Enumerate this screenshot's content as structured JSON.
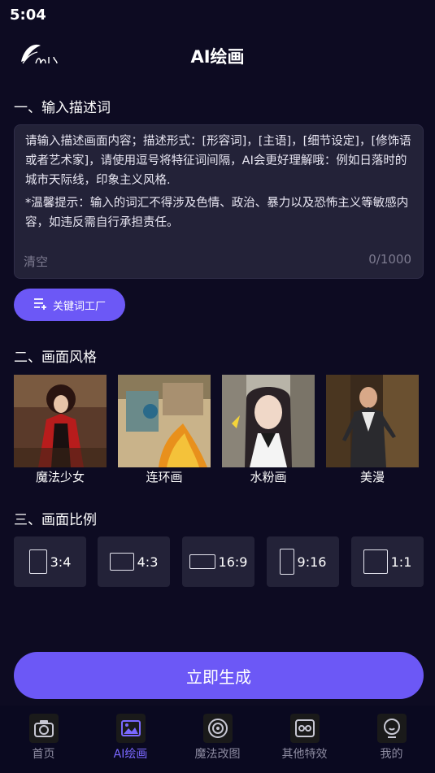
{
  "status_bar": {
    "time": "5:04"
  },
  "header": {
    "title": "AI绘画"
  },
  "section_prompt": {
    "title": "一、输入描述词",
    "placeholder": "请输入描述画面内容；描述形式：[形容词]，[主语]，[细节设定]，[修饰语或者艺术家]，请使用逗号将特征词间隔，AI会更好理解哦：例如日落时的城市天际线，印象主义风格.",
    "tip": "*温馨提示：输入的词汇不得涉及色情、政治、暴力以及恐怖主义等敏感内容，如违反需自行承担责任。",
    "clear_label": "清空",
    "char_count": "0/1000",
    "keyword_button": "关键词工厂"
  },
  "section_style": {
    "title": "二、画面风格",
    "styles": [
      {
        "label": "魔法少女"
      },
      {
        "label": "连环画"
      },
      {
        "label": "水粉画"
      },
      {
        "label": "美漫"
      }
    ]
  },
  "section_ratio": {
    "title": "三、画面比例",
    "ratios": [
      {
        "label": "3:4"
      },
      {
        "label": "4:3"
      },
      {
        "label": "16:9"
      },
      {
        "label": "9:16"
      },
      {
        "label": "1:1"
      }
    ]
  },
  "generate_button": "立即生成",
  "bottom_nav": {
    "active": "AI绘画",
    "items": [
      {
        "label": "首页",
        "icon": "camera-icon"
      },
      {
        "label": "AI绘画",
        "icon": "picture-icon"
      },
      {
        "label": "魔法改图",
        "icon": "target-icon"
      },
      {
        "label": "其他特效",
        "icon": "effects-icon"
      },
      {
        "label": "我的",
        "icon": "profile-icon"
      }
    ]
  },
  "colors": {
    "background": "#0d0b22",
    "accent": "#6c58f6",
    "card": "#232238",
    "muted_text": "#7d7b90"
  }
}
